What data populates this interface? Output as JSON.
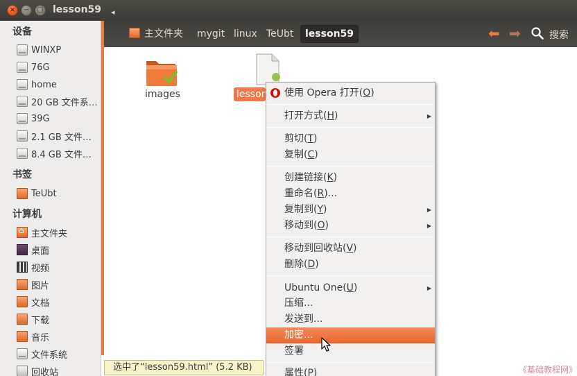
{
  "window": {
    "title": "lesson59"
  },
  "sidebar": {
    "devices_header": "设备",
    "devices": [
      {
        "label": "WINXP",
        "icon": "drive-icon"
      },
      {
        "label": "76G",
        "icon": "drive-icon"
      },
      {
        "label": "home",
        "icon": "drive-icon"
      },
      {
        "label": "20 GB 文件系…",
        "icon": "drive-icon"
      },
      {
        "label": "39G",
        "icon": "drive-icon"
      },
      {
        "label": "2.1 GB 文件…",
        "icon": "drive-icon"
      },
      {
        "label": "8.4 GB 文件…",
        "icon": "drive-icon"
      }
    ],
    "bookmarks_header": "书签",
    "bookmarks": [
      {
        "label": "TeUbt",
        "icon": "folder-icon"
      }
    ],
    "computer_header": "计算机",
    "computer": [
      {
        "label": "主文件夹",
        "icon": "home-folder-icon"
      },
      {
        "label": "桌面",
        "icon": "desktop-icon"
      },
      {
        "label": "视频",
        "icon": "video-icon"
      },
      {
        "label": "图片",
        "icon": "pictures-icon"
      },
      {
        "label": "文档",
        "icon": "documents-icon"
      },
      {
        "label": "下载",
        "icon": "downloads-icon"
      },
      {
        "label": "音乐",
        "icon": "music-icon"
      },
      {
        "label": "文件系统",
        "icon": "filesystem-icon"
      },
      {
        "label": "回收站",
        "icon": "trash-icon"
      }
    ]
  },
  "pathbar": {
    "crumbs": [
      "主文件夹",
      "mygit",
      "linux",
      "TeUbt",
      "lesson59"
    ],
    "search_label": "搜索"
  },
  "files": [
    {
      "name": "images",
      "icon": "folder-icon",
      "selected": false
    },
    {
      "name": "lesson",
      "icon": "html-file-icon",
      "selected": true
    }
  ],
  "statusbar": {
    "text": "选中了“lesson59.html” (5.2 KB)"
  },
  "context_menu": {
    "items": [
      {
        "id": "open-opera",
        "pre": "使用 Opera 打开(",
        "key": "O",
        "post": ")"
      },
      {
        "id": "open-with",
        "pre": "打开方式(",
        "key": "H",
        "post": ")"
      },
      {
        "id": "cut",
        "pre": "剪切(",
        "key": "T",
        "post": ")"
      },
      {
        "id": "copy",
        "pre": "复制(",
        "key": "C",
        "post": ")"
      },
      {
        "id": "make-link",
        "pre": "创建链接(",
        "key": "K",
        "post": ")"
      },
      {
        "id": "rename",
        "pre": "重命名(",
        "key": "R",
        "post": ")..."
      },
      {
        "id": "copy-to",
        "pre": "复制到(",
        "key": "Y",
        "post": ")"
      },
      {
        "id": "move-to",
        "pre": "移动到(",
        "key": "O",
        "post": ")"
      },
      {
        "id": "move-to-trash",
        "pre": "移动到回收站(",
        "key": "V",
        "post": ")"
      },
      {
        "id": "delete",
        "pre": "删除(",
        "key": "D",
        "post": ")"
      },
      {
        "id": "ubuntu-one",
        "pre": "Ubuntu One(",
        "key": "U",
        "post": ")"
      },
      {
        "id": "compress",
        "pre": "压缩...",
        "key": "",
        "post": ""
      },
      {
        "id": "send-to",
        "pre": "发送到...",
        "key": "",
        "post": ""
      },
      {
        "id": "encrypt",
        "pre": "加密...",
        "key": "",
        "post": ""
      },
      {
        "id": "sign",
        "pre": "签署",
        "key": "",
        "post": ""
      },
      {
        "id": "properties",
        "pre": "属性(",
        "key": "P",
        "post": ")"
      }
    ]
  },
  "watermark": "《基础教程网》",
  "colors": {
    "accent": "#f07746",
    "titlebar": "#3c3b37",
    "sidebar": "#eeedeb"
  }
}
